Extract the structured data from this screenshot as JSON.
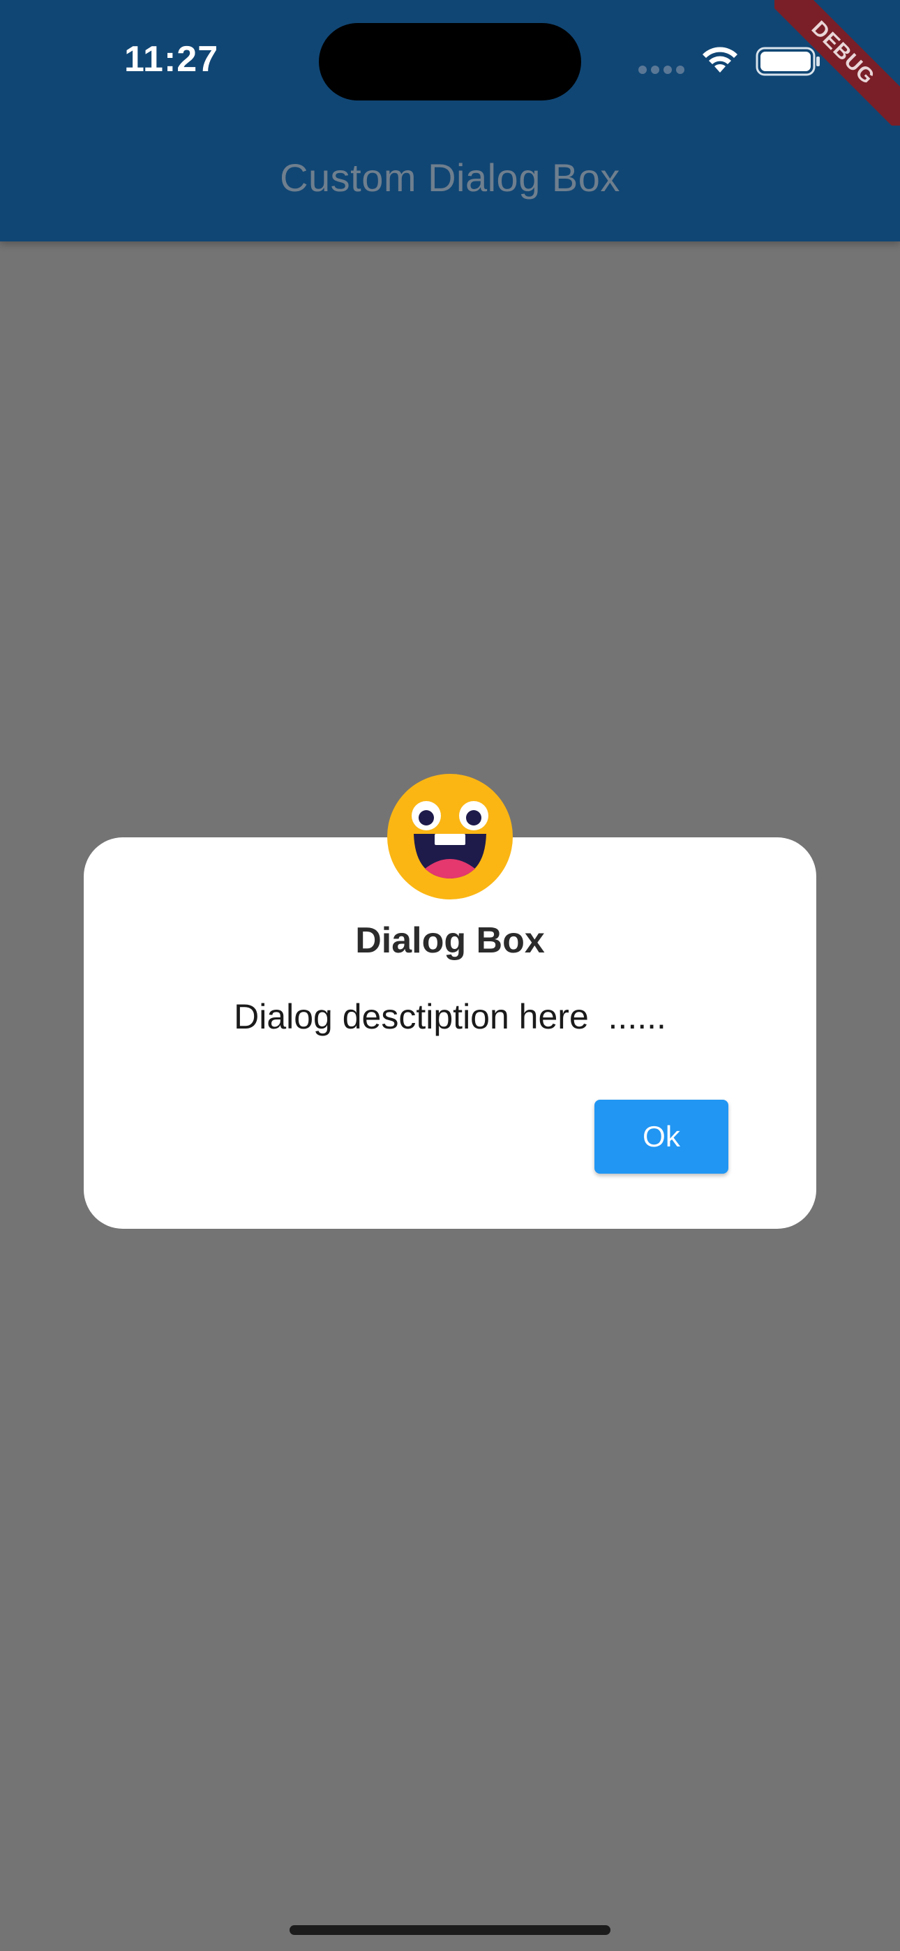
{
  "status_bar": {
    "time": "11:27"
  },
  "app_bar": {
    "title": "Custom Dialog Box",
    "color": "#104674"
  },
  "debug_banner": {
    "label": "DEBUG",
    "color": "#7a1f27"
  },
  "dialog": {
    "icon": "smiley-face-icon",
    "title": "Dialog Box",
    "description": "Dialog desctiption here  ......",
    "ok_label": "Ok",
    "button_color": "#2196f3"
  },
  "colors": {
    "barrier": "#747474",
    "emoji_yellow": "#fbb614"
  }
}
